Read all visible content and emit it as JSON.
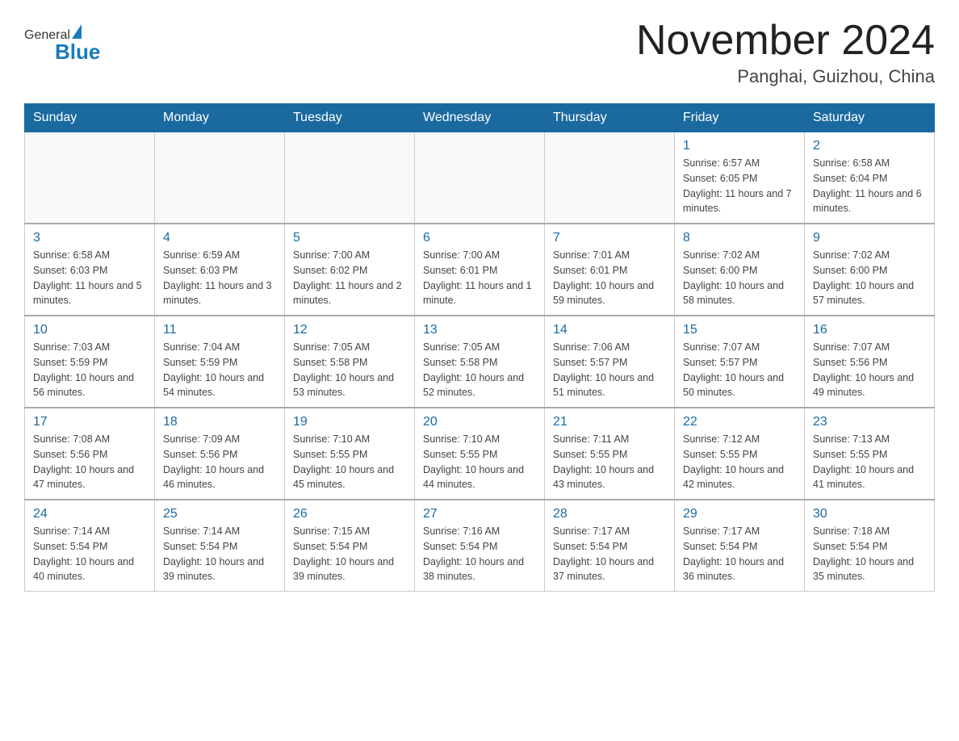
{
  "header": {
    "logo": {
      "general": "General",
      "blue": "Blue"
    },
    "title": "November 2024",
    "subtitle": "Panghai, Guizhou, China"
  },
  "weekdays": [
    "Sunday",
    "Monday",
    "Tuesday",
    "Wednesday",
    "Thursday",
    "Friday",
    "Saturday"
  ],
  "weeks": [
    [
      {
        "day": "",
        "info": ""
      },
      {
        "day": "",
        "info": ""
      },
      {
        "day": "",
        "info": ""
      },
      {
        "day": "",
        "info": ""
      },
      {
        "day": "",
        "info": ""
      },
      {
        "day": "1",
        "info": "Sunrise: 6:57 AM\nSunset: 6:05 PM\nDaylight: 11 hours and 7 minutes."
      },
      {
        "day": "2",
        "info": "Sunrise: 6:58 AM\nSunset: 6:04 PM\nDaylight: 11 hours and 6 minutes."
      }
    ],
    [
      {
        "day": "3",
        "info": "Sunrise: 6:58 AM\nSunset: 6:03 PM\nDaylight: 11 hours and 5 minutes."
      },
      {
        "day": "4",
        "info": "Sunrise: 6:59 AM\nSunset: 6:03 PM\nDaylight: 11 hours and 3 minutes."
      },
      {
        "day": "5",
        "info": "Sunrise: 7:00 AM\nSunset: 6:02 PM\nDaylight: 11 hours and 2 minutes."
      },
      {
        "day": "6",
        "info": "Sunrise: 7:00 AM\nSunset: 6:01 PM\nDaylight: 11 hours and 1 minute."
      },
      {
        "day": "7",
        "info": "Sunrise: 7:01 AM\nSunset: 6:01 PM\nDaylight: 10 hours and 59 minutes."
      },
      {
        "day": "8",
        "info": "Sunrise: 7:02 AM\nSunset: 6:00 PM\nDaylight: 10 hours and 58 minutes."
      },
      {
        "day": "9",
        "info": "Sunrise: 7:02 AM\nSunset: 6:00 PM\nDaylight: 10 hours and 57 minutes."
      }
    ],
    [
      {
        "day": "10",
        "info": "Sunrise: 7:03 AM\nSunset: 5:59 PM\nDaylight: 10 hours and 56 minutes."
      },
      {
        "day": "11",
        "info": "Sunrise: 7:04 AM\nSunset: 5:59 PM\nDaylight: 10 hours and 54 minutes."
      },
      {
        "day": "12",
        "info": "Sunrise: 7:05 AM\nSunset: 5:58 PM\nDaylight: 10 hours and 53 minutes."
      },
      {
        "day": "13",
        "info": "Sunrise: 7:05 AM\nSunset: 5:58 PM\nDaylight: 10 hours and 52 minutes."
      },
      {
        "day": "14",
        "info": "Sunrise: 7:06 AM\nSunset: 5:57 PM\nDaylight: 10 hours and 51 minutes."
      },
      {
        "day": "15",
        "info": "Sunrise: 7:07 AM\nSunset: 5:57 PM\nDaylight: 10 hours and 50 minutes."
      },
      {
        "day": "16",
        "info": "Sunrise: 7:07 AM\nSunset: 5:56 PM\nDaylight: 10 hours and 49 minutes."
      }
    ],
    [
      {
        "day": "17",
        "info": "Sunrise: 7:08 AM\nSunset: 5:56 PM\nDaylight: 10 hours and 47 minutes."
      },
      {
        "day": "18",
        "info": "Sunrise: 7:09 AM\nSunset: 5:56 PM\nDaylight: 10 hours and 46 minutes."
      },
      {
        "day": "19",
        "info": "Sunrise: 7:10 AM\nSunset: 5:55 PM\nDaylight: 10 hours and 45 minutes."
      },
      {
        "day": "20",
        "info": "Sunrise: 7:10 AM\nSunset: 5:55 PM\nDaylight: 10 hours and 44 minutes."
      },
      {
        "day": "21",
        "info": "Sunrise: 7:11 AM\nSunset: 5:55 PM\nDaylight: 10 hours and 43 minutes."
      },
      {
        "day": "22",
        "info": "Sunrise: 7:12 AM\nSunset: 5:55 PM\nDaylight: 10 hours and 42 minutes."
      },
      {
        "day": "23",
        "info": "Sunrise: 7:13 AM\nSunset: 5:55 PM\nDaylight: 10 hours and 41 minutes."
      }
    ],
    [
      {
        "day": "24",
        "info": "Sunrise: 7:14 AM\nSunset: 5:54 PM\nDaylight: 10 hours and 40 minutes."
      },
      {
        "day": "25",
        "info": "Sunrise: 7:14 AM\nSunset: 5:54 PM\nDaylight: 10 hours and 39 minutes."
      },
      {
        "day": "26",
        "info": "Sunrise: 7:15 AM\nSunset: 5:54 PM\nDaylight: 10 hours and 39 minutes."
      },
      {
        "day": "27",
        "info": "Sunrise: 7:16 AM\nSunset: 5:54 PM\nDaylight: 10 hours and 38 minutes."
      },
      {
        "day": "28",
        "info": "Sunrise: 7:17 AM\nSunset: 5:54 PM\nDaylight: 10 hours and 37 minutes."
      },
      {
        "day": "29",
        "info": "Sunrise: 7:17 AM\nSunset: 5:54 PM\nDaylight: 10 hours and 36 minutes."
      },
      {
        "day": "30",
        "info": "Sunrise: 7:18 AM\nSunset: 5:54 PM\nDaylight: 10 hours and 35 minutes."
      }
    ]
  ]
}
